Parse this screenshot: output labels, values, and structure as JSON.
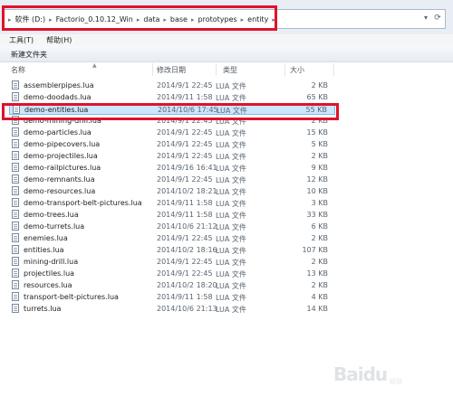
{
  "address": {
    "crumbs": [
      "软件 (D:)",
      "Factorio_0.10.12_Win",
      "data",
      "base",
      "prototypes",
      "entity"
    ],
    "separator": "▸",
    "dropdown_icon": "chevron-down-icon",
    "refresh_icon": "refresh-icon"
  },
  "menu": {
    "items": [
      "工具(T)",
      "帮助(H)"
    ]
  },
  "toolbar": {
    "new_folder_label": "新建文件夹"
  },
  "columns": {
    "name": "名称",
    "date": "修改日期",
    "type": "类型",
    "size": "大小"
  },
  "files": [
    {
      "name": "assemblerpipes.lua",
      "date": "2014/9/1 22:45",
      "type": "LUA 文件",
      "size": "2 KB"
    },
    {
      "name": "demo-doodads.lua",
      "date": "2014/9/11 1:58",
      "type": "LUA 文件",
      "size": "65 KB"
    },
    {
      "name": "demo-entities.lua",
      "date": "2014/10/6 17:45",
      "type": "LUA 文件",
      "size": "55 KB",
      "selected": true
    },
    {
      "name": "demo-mining-drill.lua",
      "date": "2014/9/1 22:45",
      "type": "LUA 文件",
      "size": "2 KB"
    },
    {
      "name": "demo-particles.lua",
      "date": "2014/9/1 22:45",
      "type": "LUA 文件",
      "size": "15 KB"
    },
    {
      "name": "demo-pipecovers.lua",
      "date": "2014/9/1 22:45",
      "type": "LUA 文件",
      "size": "5 KB"
    },
    {
      "name": "demo-projectiles.lua",
      "date": "2014/9/1 22:45",
      "type": "LUA 文件",
      "size": "2 KB"
    },
    {
      "name": "demo-railpictures.lua",
      "date": "2014/9/16 16:41",
      "type": "LUA 文件",
      "size": "9 KB"
    },
    {
      "name": "demo-remnants.lua",
      "date": "2014/9/1 22:45",
      "type": "LUA 文件",
      "size": "12 KB"
    },
    {
      "name": "demo-resources.lua",
      "date": "2014/10/2 18:21",
      "type": "LUA 文件",
      "size": "10 KB"
    },
    {
      "name": "demo-transport-belt-pictures.lua",
      "date": "2014/9/11 1:58",
      "type": "LUA 文件",
      "size": "3 KB"
    },
    {
      "name": "demo-trees.lua",
      "date": "2014/9/11 1:58",
      "type": "LUA 文件",
      "size": "33 KB"
    },
    {
      "name": "demo-turrets.lua",
      "date": "2014/10/6 21:12",
      "type": "LUA 文件",
      "size": "6 KB"
    },
    {
      "name": "enemies.lua",
      "date": "2014/9/1 22:45",
      "type": "LUA 文件",
      "size": "2 KB"
    },
    {
      "name": "entities.lua",
      "date": "2014/10/2 18:16",
      "type": "LUA 文件",
      "size": "107 KB"
    },
    {
      "name": "mining-drill.lua",
      "date": "2014/9/1 22:45",
      "type": "LUA 文件",
      "size": "2 KB"
    },
    {
      "name": "projectiles.lua",
      "date": "2014/9/1 22:45",
      "type": "LUA 文件",
      "size": "13 KB"
    },
    {
      "name": "resources.lua",
      "date": "2014/10/2 18:20",
      "type": "LUA 文件",
      "size": "2 KB"
    },
    {
      "name": "transport-belt-pictures.lua",
      "date": "2014/9/11 1:58",
      "type": "LUA 文件",
      "size": "4 KB"
    },
    {
      "name": "turrets.lua",
      "date": "2014/10/6 21:13",
      "type": "LUA 文件",
      "size": "14 KB"
    }
  ],
  "watermark": {
    "logo": "Baidu",
    "sub": "经验"
  },
  "colors": {
    "highlight": "#e0112b",
    "selection": "#cce6fb"
  }
}
